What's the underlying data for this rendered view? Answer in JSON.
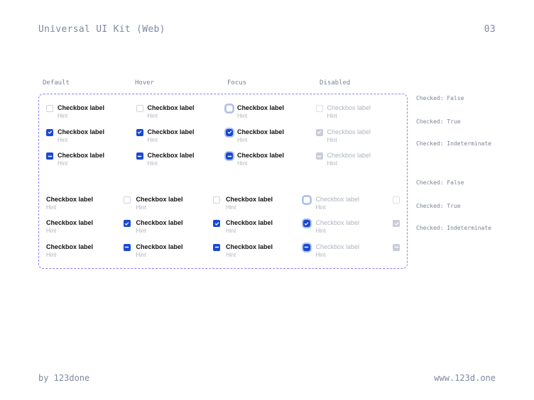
{
  "header": {
    "title": "Universal UI Kit (Web)",
    "page": "03"
  },
  "footer": {
    "author": "by 123done",
    "site": "www.123d.one"
  },
  "columns": [
    "Default",
    "Hover",
    "Focus",
    "Disabled"
  ],
  "row_labels": [
    "Checked: False",
    "Checked: True",
    "Checked: Indeterminate",
    "Checked: False",
    "Checked: True",
    "Checked: Indeterminate"
  ],
  "cell": {
    "label": "Checkbox label",
    "hint": "Hint"
  }
}
